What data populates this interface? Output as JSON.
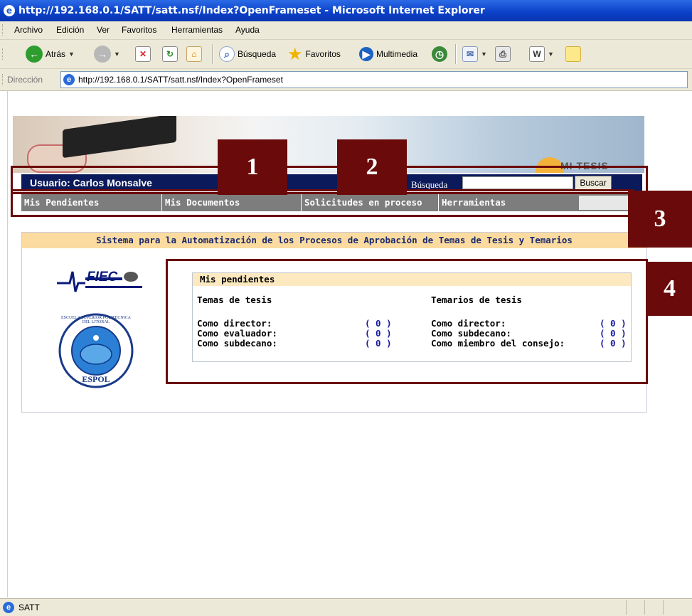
{
  "window": {
    "title": "http://192.168.0.1/SATT/satt.nsf/Index?OpenFrameset - Microsoft Internet Explorer"
  },
  "menu": [
    "Archivo",
    "Edición",
    "Ver",
    "Favoritos",
    "Herramientas",
    "Ayuda"
  ],
  "toolbar": {
    "back_label": "Atrás",
    "search_label": "Búsqueda",
    "favorites_label": "Favoritos",
    "media_label": "Multimedia"
  },
  "address": {
    "label": "Dirección",
    "url": "http://192.168.0.1/SATT/satt.nsf/Index?OpenFrameset"
  },
  "banner": {
    "brand_text": "MI TESIS"
  },
  "user_bar": {
    "user_label": "Usuario: Carlos Monsalve",
    "search_label": "Búsqueda",
    "search_value": "",
    "search_button": "Buscar"
  },
  "nav": [
    "Mis Pendientes",
    "Mis Documentos",
    "Solicitudes en proceso",
    "Herramientas"
  ],
  "system_title": "Sistema para la Automatización de los Procesos de Aprobación de Temas de Tesis y Temarios",
  "logos": {
    "fiec": "FIEC",
    "espol": "ESPOL",
    "espol_ring": "ESCUELA SUPERIOR POLITECNICA DEL LITORAL"
  },
  "pending": {
    "title": "Mis pendientes",
    "temas": {
      "heading": "Temas de tesis",
      "rows": [
        {
          "label": "Como director:",
          "count": "( 0 )"
        },
        {
          "label": "Como evaluador:",
          "count": "( 0 )"
        },
        {
          "label": "Como subdecano:",
          "count": "( 0 )"
        }
      ]
    },
    "temarios": {
      "heading": "Temarios de tesis",
      "rows": [
        {
          "label": "Como director:",
          "count": "( 0 )"
        },
        {
          "label": "Como subdecano:",
          "count": "( 0 )"
        },
        {
          "label": "Como miembro del consejo:",
          "count": "( 0 )"
        }
      ]
    }
  },
  "annotations": [
    "1",
    "2",
    "3",
    "4"
  ],
  "annotation_color": "#6b0a0a",
  "status": {
    "text": "SATT"
  }
}
